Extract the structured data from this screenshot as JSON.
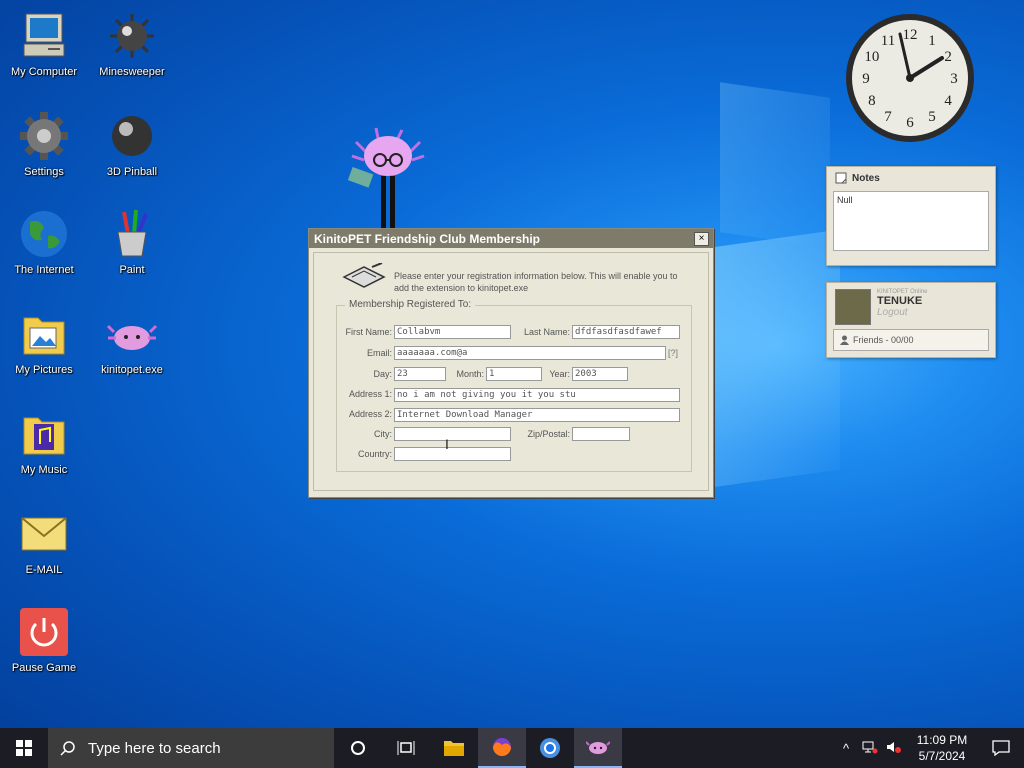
{
  "desktop": {
    "icons": [
      {
        "label": "My Computer",
        "icon": "computer-icon"
      },
      {
        "label": "Minesweeper",
        "icon": "mine-icon"
      },
      {
        "label": "Settings",
        "icon": "gear-icon"
      },
      {
        "label": "3D Pinball",
        "icon": "pinball-icon"
      },
      {
        "label": "The Internet",
        "icon": "globe-icon"
      },
      {
        "label": "Paint",
        "icon": "paint-icon"
      },
      {
        "label": "My Pictures",
        "icon": "pictures-folder-icon"
      },
      {
        "label": "kinitopet.exe",
        "icon": "axolotl-icon"
      },
      {
        "label": "My Music",
        "icon": "music-folder-icon"
      },
      {
        "label": "E-MAIL",
        "icon": "envelope-icon"
      },
      {
        "label": "Pause Game",
        "icon": "power-icon"
      }
    ]
  },
  "clock_widget": {
    "numerals": [
      "12",
      "1",
      "2",
      "3",
      "4",
      "5",
      "6",
      "7",
      "8",
      "9",
      "10",
      "11"
    ]
  },
  "notes_widget": {
    "title": "Notes",
    "content": "Null"
  },
  "profile_widget": {
    "small_text": "KINITOPET Online",
    "name": "TENUKE",
    "logout": "Logout",
    "friends": "Friends - 00/00"
  },
  "dialog": {
    "title": "KinitoPET Friendship Club Membership",
    "close": "×",
    "intro": "Please enter your registration information below. This will enable you to add the extension to kinitopet.exe",
    "legend": "Membership Registered To:",
    "fields": {
      "first_name_label": "First Name:",
      "first_name": "Collabvm",
      "last_name_label": "Last Name:",
      "last_name": "dfdfasdfasdfawef",
      "email_label": "Email:",
      "email": "aaaaaaa.com@a",
      "email_help": "[?]",
      "day_label": "Day:",
      "day": "23",
      "month_label": "Month:",
      "month": "1",
      "year_label": "Year:",
      "year": "2003",
      "address1_label": "Address 1:",
      "address1": "no i am not giving you it you stu",
      "address2_label": "Address 2:",
      "address2": "Internet Download Manager",
      "city_label": "City:",
      "city": "",
      "zip_label": "Zip/Postal:",
      "zip": "",
      "country_label": "Country:",
      "country": ""
    }
  },
  "taskbar": {
    "search_placeholder": "Type here to search",
    "time": "11:09 PM",
    "date": "5/7/2024",
    "apps": [
      "task-view",
      "file-explorer",
      "firefox",
      "chrome",
      "kinitopet"
    ]
  },
  "colors": {
    "accent": "#0a6cd8",
    "dialog_bg": "#e9e7d8",
    "titlebar": "#7e7b6a"
  }
}
